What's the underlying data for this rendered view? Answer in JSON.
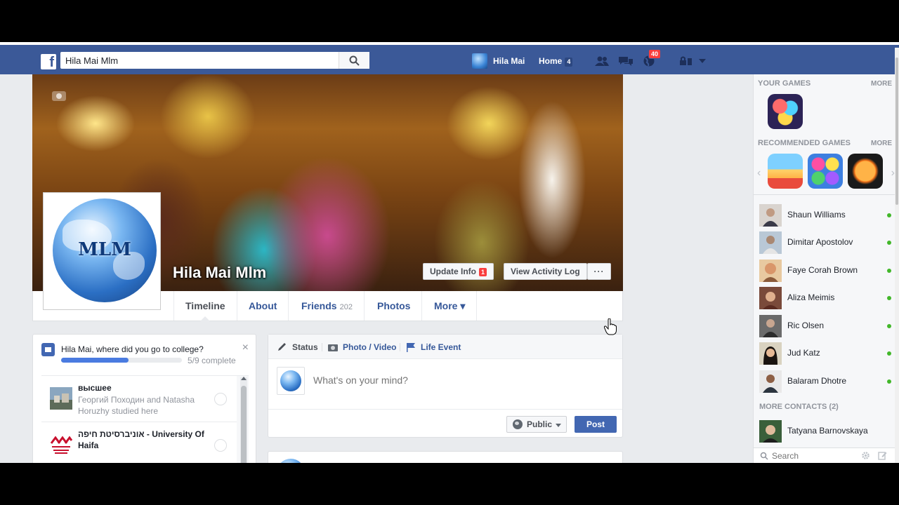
{
  "topbar": {
    "logo": "f",
    "search_value": "Hila Mai Mlm",
    "user_name": "Hila Mai",
    "home_label": "Home",
    "home_count": "4",
    "notifications_count": "40",
    "brand_color": "#3b5998"
  },
  "profile": {
    "name": "Hila Mai Mlm",
    "picture_text": "MLM",
    "update_info_label": "Update Info",
    "update_info_count": "1",
    "activity_log_label": "View Activity Log",
    "more_label": "···"
  },
  "tabs": [
    {
      "label": "Timeline",
      "count": ""
    },
    {
      "label": "About",
      "count": ""
    },
    {
      "label": "Friends",
      "count": "202"
    },
    {
      "label": "Photos",
      "count": ""
    },
    {
      "label": "More ▾",
      "count": ""
    }
  ],
  "college": {
    "question": "Hila Mai, where did you go to college?",
    "close": "×",
    "progress_text": "5/9 complete",
    "progress_fraction": 0.5556,
    "schools": [
      {
        "name": "высшее",
        "sub": "Георгий Походин and Natasha Horuzhy studied here"
      },
      {
        "name": "אוניברסיטת חיפה - University Of Haifa",
        "sub": ""
      }
    ]
  },
  "composer": {
    "tabs": [
      {
        "label": "Status"
      },
      {
        "label": "Photo / Video"
      },
      {
        "label": "Life Event"
      }
    ],
    "placeholder": "What's on your mind?",
    "privacy_label": "Public",
    "post_label": "Post"
  },
  "sidebar": {
    "your_games_label": "YOUR GAMES",
    "recommended_games_label": "RECOMMENDED GAMES",
    "more_label": "MORE",
    "more_contacts_label": "MORE CONTACTS (2)",
    "contacts": [
      {
        "name": "Shaun Williams"
      },
      {
        "name": "Dimitar Apostolov"
      },
      {
        "name": "Faye Corah Brown"
      },
      {
        "name": "Aliza Meimis"
      },
      {
        "name": "Ric Olsen"
      },
      {
        "name": "Jud Katz"
      },
      {
        "name": "Balaram Dhotre"
      }
    ],
    "more_contacts": [
      {
        "name": "Tatyana Barnovskaya"
      }
    ],
    "search_placeholder": "Search"
  }
}
